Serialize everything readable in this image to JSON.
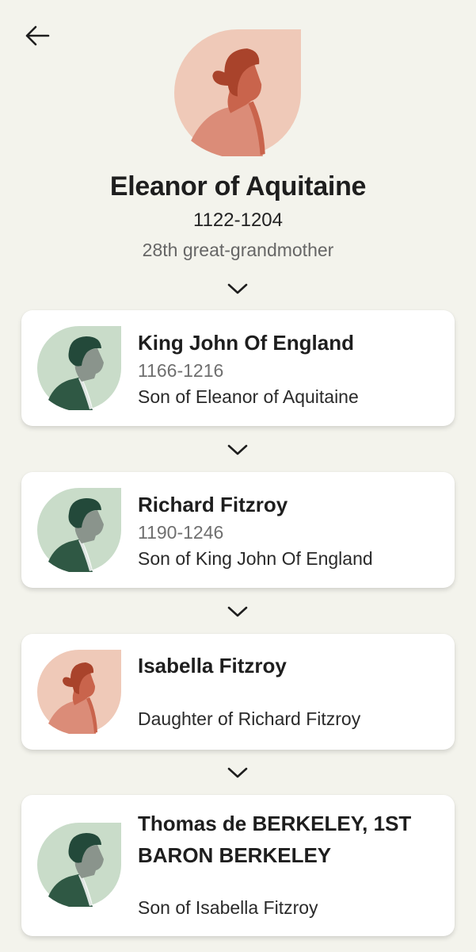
{
  "header": {
    "back_icon": "arrow-left-icon",
    "name": "Eleanor of Aquitaine",
    "years": "1122-1204",
    "relation": "28th great-grandmother",
    "avatar": "female-silhouette-icon"
  },
  "colors": {
    "background": "#f3f3ec",
    "female_bg": "#efc9b8",
    "female_shirt": "#db8c78",
    "female_skin": "#c9644c",
    "female_hair": "#a9432b",
    "male_bg": "#c9dcc9",
    "male_shirt": "#2f5844",
    "male_skin": "#8a948c",
    "male_hair": "#23493a"
  },
  "chain": [
    {
      "name": "King John Of England",
      "years": "1166-1216",
      "relation": "Son of Eleanor of Aquitaine",
      "avatar": "male-silhouette-icon"
    },
    {
      "name": "Richard Fitzroy",
      "years": "1190-1246",
      "relation": "Son of King John Of England",
      "avatar": "male-silhouette-icon"
    },
    {
      "name": "Isabella Fitzroy",
      "years": "",
      "relation": "Daughter of Richard Fitzroy",
      "avatar": "female-silhouette-icon"
    },
    {
      "name": "Thomas de BERKELEY, 1ST BARON BERKELEY",
      "years": "",
      "relation": "Son of Isabella Fitzroy",
      "avatar": "male-silhouette-icon"
    }
  ]
}
